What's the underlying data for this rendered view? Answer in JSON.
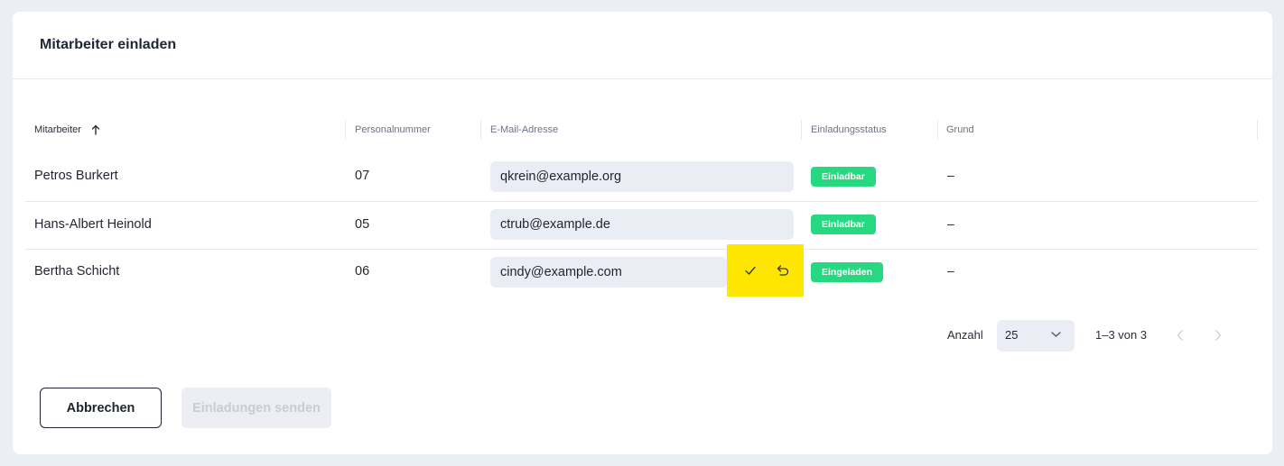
{
  "dialog": {
    "title": "Mitarbeiter einladen"
  },
  "table": {
    "headers": {
      "employee": "Mitarbeiter",
      "personnel_number": "Personalnummer",
      "email": "E-Mail-Adresse",
      "invite_status": "Einladungsstatus",
      "reason": "Grund"
    },
    "sort": {
      "column": "Mitarbeiter",
      "direction": "ascending"
    },
    "rows": [
      {
        "name": "Petros Burkert",
        "number": "07",
        "email": "qkrein@example.org",
        "status": "Einladbar",
        "reason": "–"
      },
      {
        "name": "Hans-Albert Heinold",
        "number": "05",
        "email": "ctrub@example.de",
        "status": "Einladbar",
        "reason": "–"
      },
      {
        "name": "Bertha Schicht",
        "number": "06",
        "email": "cindy@example.com",
        "status": "Eingeladen",
        "reason": "–"
      }
    ],
    "row_actions": {
      "confirm_icon": "check-icon",
      "undo_icon": "undo-icon",
      "highlight_color": "#ffe600"
    }
  },
  "pagination": {
    "rows_label": "Anzahl",
    "rows_per_page": "25",
    "range": "1–3 von 3",
    "prev_icon": "chevron-left-icon",
    "next_icon": "chevron-right-icon"
  },
  "footer": {
    "cancel_label": "Abbrechen",
    "send_label": "Einladungen senden"
  },
  "colors": {
    "status_badge": "#26d87f",
    "background": "#eceef5",
    "input_fill": "#ebedf4"
  }
}
